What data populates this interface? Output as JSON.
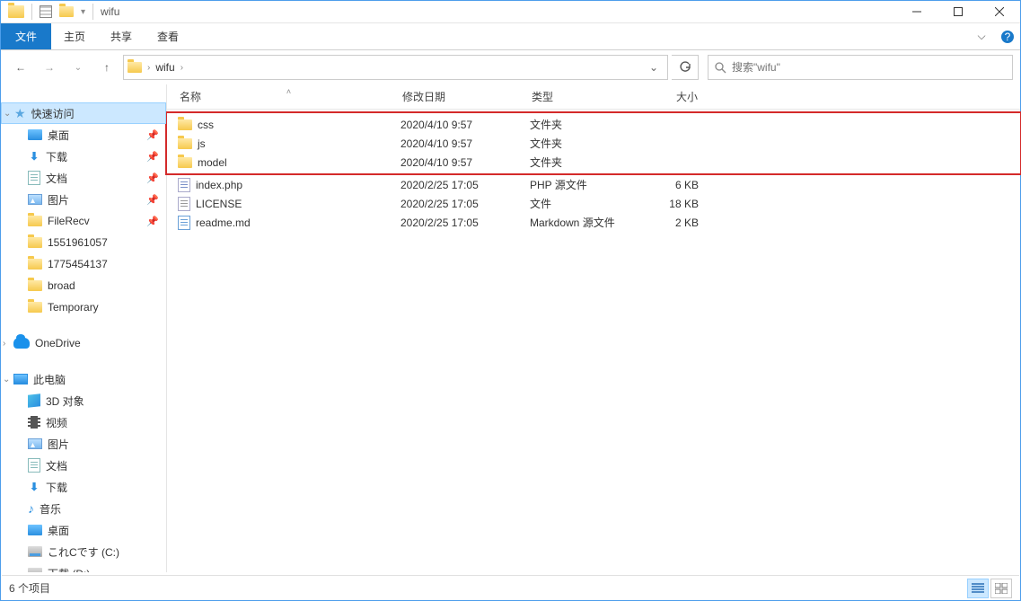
{
  "window": {
    "title": "wifu"
  },
  "ribbon": {
    "file": "文件",
    "tabs": [
      "主页",
      "共享",
      "查看"
    ]
  },
  "address": {
    "crumbs": [
      "wifu"
    ],
    "search_placeholder": "搜索\"wifu\""
  },
  "sidebar": {
    "quick_access": {
      "label": "快速访问",
      "items": [
        {
          "label": "桌面",
          "icon": "desktop",
          "pinned": true
        },
        {
          "label": "下载",
          "icon": "download",
          "pinned": true
        },
        {
          "label": "文档",
          "icon": "doc",
          "pinned": true
        },
        {
          "label": "图片",
          "icon": "pic",
          "pinned": true
        },
        {
          "label": "FileRecv",
          "icon": "folder",
          "pinned": true
        },
        {
          "label": "1551961057",
          "icon": "folder",
          "pinned": false
        },
        {
          "label": "1775454137",
          "icon": "folder",
          "pinned": false
        },
        {
          "label": "broad",
          "icon": "folder",
          "pinned": false
        },
        {
          "label": "Temporary",
          "icon": "folder",
          "pinned": false
        }
      ]
    },
    "onedrive": {
      "label": "OneDrive"
    },
    "this_pc": {
      "label": "此电脑",
      "items": [
        {
          "label": "3D 对象",
          "icon": "3d"
        },
        {
          "label": "视频",
          "icon": "video"
        },
        {
          "label": "图片",
          "icon": "pic"
        },
        {
          "label": "文档",
          "icon": "doc"
        },
        {
          "label": "下载",
          "icon": "download"
        },
        {
          "label": "音乐",
          "icon": "music"
        },
        {
          "label": "桌面",
          "icon": "desktop"
        },
        {
          "label": "これCです (C:)",
          "icon": "disk"
        },
        {
          "label": "下载 (D:)",
          "icon": "disk"
        }
      ]
    }
  },
  "columns": {
    "name": "名称",
    "date": "修改日期",
    "type": "类型",
    "size": "大小"
  },
  "files": [
    {
      "name": "css",
      "date": "2020/4/10 9:57",
      "type": "文件夹",
      "size": "",
      "icon": "folder",
      "hl": true
    },
    {
      "name": "js",
      "date": "2020/4/10 9:57",
      "type": "文件夹",
      "size": "",
      "icon": "folder",
      "hl": true
    },
    {
      "name": "model",
      "date": "2020/4/10 9:57",
      "type": "文件夹",
      "size": "",
      "icon": "folder",
      "hl": true
    },
    {
      "name": "index.php",
      "date": "2020/2/25 17:05",
      "type": "PHP 源文件",
      "size": "6 KB",
      "icon": "php"
    },
    {
      "name": "LICENSE",
      "date": "2020/2/25 17:05",
      "type": "文件",
      "size": "18 KB",
      "icon": "txt"
    },
    {
      "name": "readme.md",
      "date": "2020/2/25 17:05",
      "type": "Markdown 源文件",
      "size": "2 KB",
      "icon": "md"
    }
  ],
  "status": {
    "count_label": "6 个项目"
  }
}
